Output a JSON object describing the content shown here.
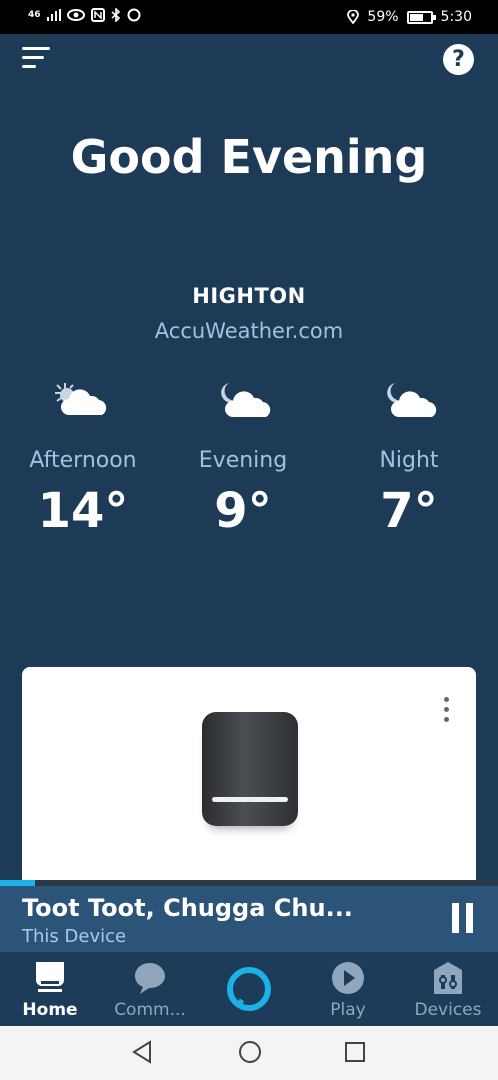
{
  "status_bar": {
    "network": "46",
    "battery": "59%",
    "time": "5:30"
  },
  "header": {
    "help_label": "?"
  },
  "greeting": "Good Evening",
  "weather": {
    "location": "HIGHTON",
    "source": "AccuWeather.com",
    "periods": [
      {
        "label": "Afternoon",
        "temp": "14°",
        "icon": "sun-cloud-icon"
      },
      {
        "label": "Evening",
        "temp": "9°",
        "icon": "moon-cloud-icon"
      },
      {
        "label": "Night",
        "temp": "7°",
        "icon": "moon-cloud-icon"
      }
    ]
  },
  "device_card": {
    "image": "echo-studio-speaker",
    "menu_icon": "more-vertical-icon"
  },
  "now_playing": {
    "title": "Toot Toot, Chugga Chu...",
    "subtitle": "This Device",
    "progress": 0.07
  },
  "tabs": [
    {
      "label": "Home",
      "icon": "home-icon",
      "active": true
    },
    {
      "label": "Comm...",
      "icon": "chat-icon",
      "active": false
    },
    {
      "label": "",
      "icon": "alexa-icon",
      "active": false
    },
    {
      "label": "Play",
      "icon": "play-icon",
      "active": false
    },
    {
      "label": "Devices",
      "icon": "devices-icon",
      "active": false
    }
  ],
  "colors": {
    "background": "#1d3a56",
    "accent": "#1ab3e6",
    "secondary_text": "#9ac4e0"
  }
}
